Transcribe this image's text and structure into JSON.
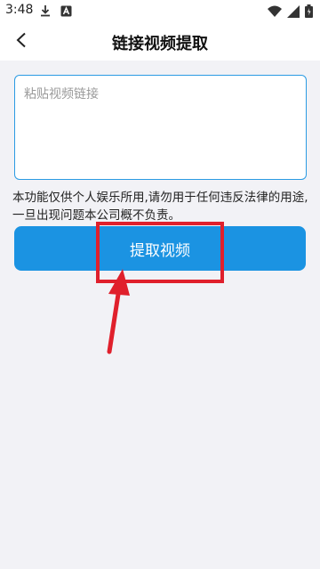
{
  "status_bar": {
    "time": "3:48",
    "icons": [
      "download-icon",
      "app-a-icon",
      "wifi-icon",
      "signal-icon",
      "battery-icon"
    ]
  },
  "header": {
    "title": "链接视频提取",
    "back_icon": "chevron-left-icon"
  },
  "form": {
    "placeholder": "粘贴视频链接",
    "value": "",
    "notice": "本功能仅供个人娱乐所用,请勿用于任何违反法律的用途,一旦出现问题本公司概不负责。",
    "button_label": "提取视频"
  },
  "colors": {
    "accent": "#1b93e2",
    "input_border": "#2b9be3",
    "annotation": "#e0202c",
    "background": "#f2f2f6"
  }
}
